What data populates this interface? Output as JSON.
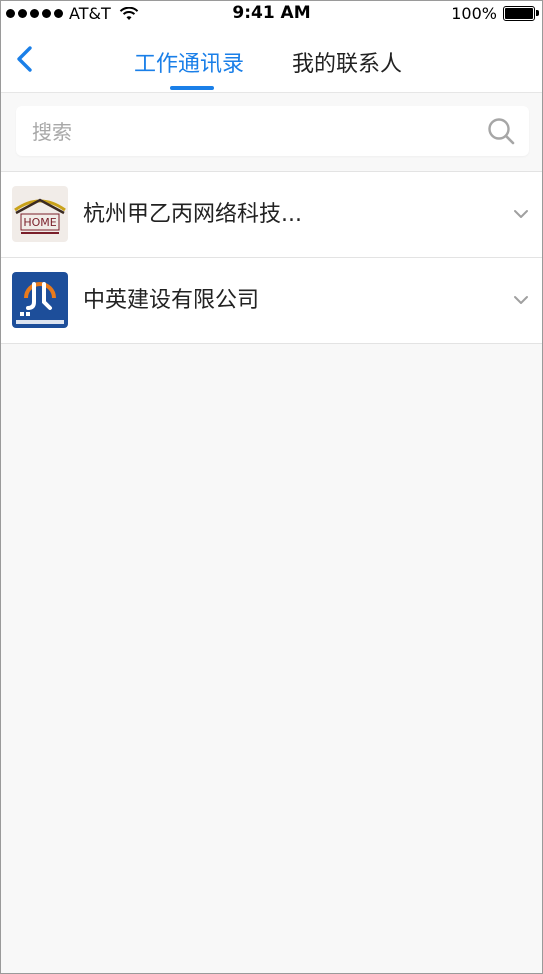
{
  "status_bar": {
    "carrier": "AT&T",
    "time": "9:41 AM",
    "battery": "100%",
    "battery_level": 1.0
  },
  "nav": {
    "tabs": [
      {
        "label": "工作通讯录",
        "active": true
      },
      {
        "label": "我的联系人",
        "active": false
      }
    ],
    "accent_color": "#1a7fe8"
  },
  "search": {
    "placeholder": "搜索",
    "value": ""
  },
  "companies": [
    {
      "name": "杭州甲乙丙网络科技...",
      "logo": "project-home-logo"
    },
    {
      "name": "中英建设有限公司",
      "logo": "shenglong-logo"
    }
  ]
}
